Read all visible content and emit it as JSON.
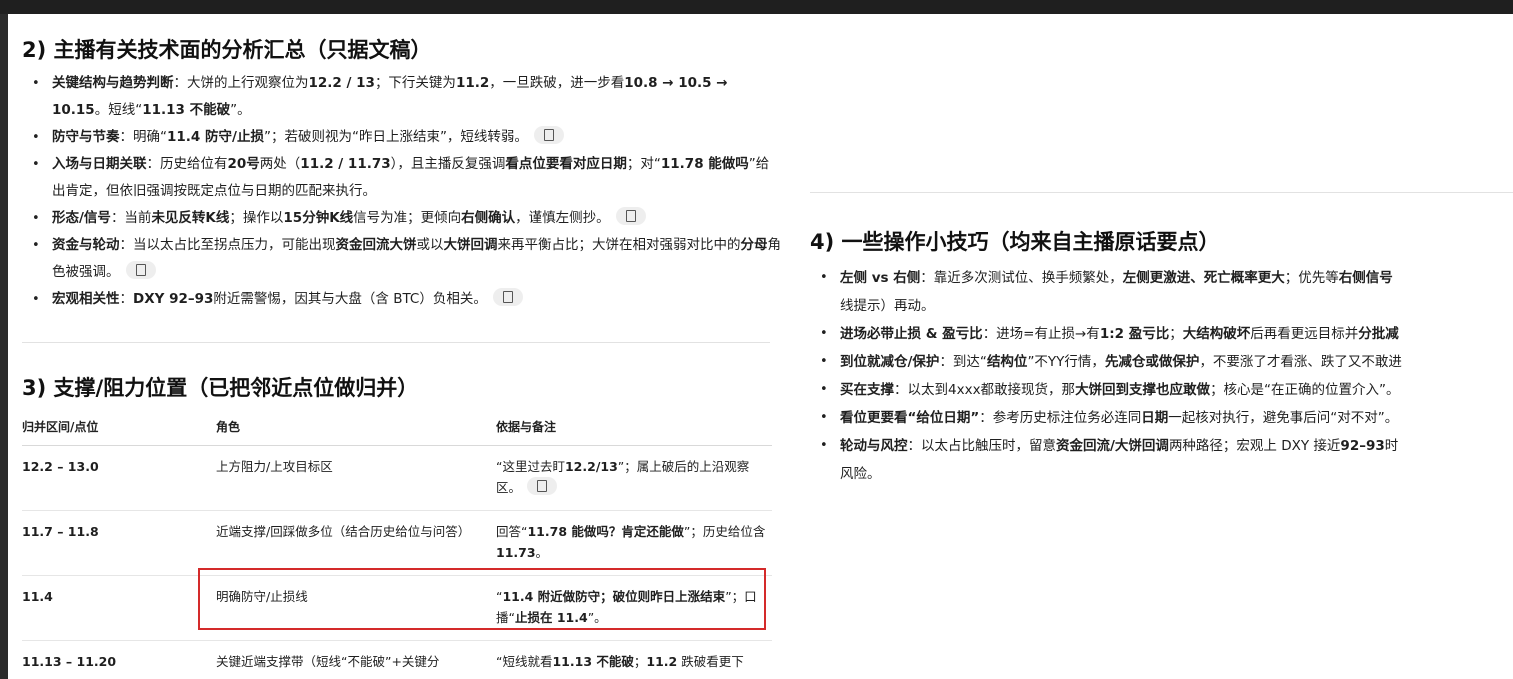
{
  "sec2": {
    "title": "2) 主播有关技术面的分析汇总（只据文稿）",
    "items": [
      {
        "lead": "关键结构与趋势判断",
        "parts": [
          {
            "t": "：大饼的上行观察位为",
            "b": false
          },
          {
            "t": "12.2 / 13",
            "b": true
          },
          {
            "t": "；下行关键为",
            "b": false
          },
          {
            "t": "11.2",
            "b": true
          },
          {
            "t": "，一旦跌破，进一步看",
            "b": false
          },
          {
            "t": "10.8 → 10.5 → 10.15",
            "b": true
          },
          {
            "t": "。短线“",
            "b": false
          },
          {
            "t": "11.13 不能破",
            "b": true
          },
          {
            "t": "”。",
            "b": false
          }
        ],
        "copy": false
      },
      {
        "lead": "防守与节奏",
        "parts": [
          {
            "t": "：明确“",
            "b": false
          },
          {
            "t": "11.4 防守/止损",
            "b": true
          },
          {
            "t": "”；若破则视为“昨日上涨结束”，短线转弱。",
            "b": false
          }
        ],
        "copy": true
      },
      {
        "lead": "入场与日期关联",
        "parts": [
          {
            "t": "：历史给位有",
            "b": false
          },
          {
            "t": "20号",
            "b": true
          },
          {
            "t": "两处（",
            "b": false
          },
          {
            "t": "11.2 / 11.73",
            "b": true
          },
          {
            "t": "），且主播反复强调",
            "b": false
          },
          {
            "t": "看点位要看对应日期",
            "b": true
          },
          {
            "t": "；对“",
            "b": false
          },
          {
            "t": "11.78 能做吗",
            "b": true
          },
          {
            "t": "”给出肯定，但依旧强调按既定点位与日期的匹配来执行。",
            "b": false
          }
        ],
        "copy": false
      },
      {
        "lead": "形态/信号",
        "parts": [
          {
            "t": "：当前",
            "b": false
          },
          {
            "t": "未见反转K线",
            "b": true
          },
          {
            "t": "；操作以",
            "b": false
          },
          {
            "t": "15分钟K线",
            "b": true
          },
          {
            "t": "信号为准；更倾向",
            "b": false
          },
          {
            "t": "右侧确认",
            "b": true
          },
          {
            "t": "，谨慎左侧抄。",
            "b": false
          }
        ],
        "copy": true
      },
      {
        "lead": "资金与轮动",
        "parts": [
          {
            "t": "：当以太占比至拐点压力，可能出现",
            "b": false
          },
          {
            "t": "资金回流大饼",
            "b": true
          },
          {
            "t": "或以",
            "b": false
          },
          {
            "t": "大饼回调",
            "b": true
          },
          {
            "t": "来再平衡占比；大饼在相对强弱对比中的",
            "b": false
          },
          {
            "t": "分母",
            "b": true
          },
          {
            "t": "角色被强调。",
            "b": false
          }
        ],
        "copy": true
      },
      {
        "lead": "宏观相关性",
        "parts": [
          {
            "t": "：",
            "b": false
          },
          {
            "t": "DXY 92–93",
            "b": true
          },
          {
            "t": "附近需警惕，因其与大盘（含 BTC）负相关。",
            "b": false
          }
        ],
        "copy": true
      }
    ]
  },
  "sec3": {
    "title": "3) 支撑/阻力位置（已把邻近点位做归并）",
    "headers": [
      "归并区间/点位",
      "角色",
      "依据与备注"
    ],
    "rows": [
      {
        "range": "12.2 – 13.0",
        "role": "上方阻力/上攻目标区",
        "note": [
          {
            "t": "“这里过去盯",
            "b": false
          },
          {
            "t": "12.2/13",
            "b": true
          },
          {
            "t": "”；属上破后的上沿观察区。",
            "b": false
          }
        ],
        "copy": true
      },
      {
        "range": "11.7 – 11.8",
        "role": "近端支撑/回踩做多位（结合历史给位与问答）",
        "note": [
          {
            "t": "回答“",
            "b": false
          },
          {
            "t": "11.78 能做吗？肯定还能做",
            "b": true
          },
          {
            "t": "”；历史给位含",
            "b": false
          },
          {
            "t": "11.73",
            "b": true
          },
          {
            "t": "。",
            "b": false
          }
        ],
        "copy": false
      },
      {
        "range": "11.4",
        "role": "明确防守/止损线",
        "note": [
          {
            "t": "“",
            "b": false
          },
          {
            "t": "11.4 附近做防守；破位则昨日上涨结束",
            "b": true
          },
          {
            "t": "”；口播“",
            "b": false
          },
          {
            "t": "止损在 11.4",
            "b": true
          },
          {
            "t": "”。",
            "b": false
          }
        ],
        "copy": false
      },
      {
        "range": "11.13 – 11.20",
        "role": "关键近端支撑带（短线“不能破”+关键分",
        "note": [
          {
            "t": "“短线就看",
            "b": false
          },
          {
            "t": "11.13 不能破",
            "b": true
          },
          {
            "t": "；",
            "b": false
          },
          {
            "t": "11.2",
            "b": true
          },
          {
            "t": " 跌破看更下",
            "b": false
          }
        ],
        "copy": false
      }
    ]
  },
  "sec4": {
    "title": "4) 一些操作小技巧（均来自主播原话要点）",
    "items": [
      {
        "lead": "左侧 vs 右侧",
        "parts": [
          {
            "t": "：靠近多次测试位、换手频繁处，",
            "b": false
          },
          {
            "t": "左侧更激进、死亡概率更大",
            "b": true
          },
          {
            "t": "；优先等",
            "b": false
          },
          {
            "t": "右侧信号",
            "b": true
          }
        ],
        "cont": "线提示）再动。"
      },
      {
        "lead": "进场必带止损 & 盈亏比",
        "parts": [
          {
            "t": "：进场=有止损→有",
            "b": false
          },
          {
            "t": "1:2 盈亏比",
            "b": true
          },
          {
            "t": "；",
            "b": false
          },
          {
            "t": "大结构破坏",
            "b": true
          },
          {
            "t": "后再看更远目标并",
            "b": false
          },
          {
            "t": "分批减",
            "b": true
          }
        ]
      },
      {
        "lead": "到位就减仓/保护",
        "parts": [
          {
            "t": "：到达“",
            "b": false
          },
          {
            "t": "结构位",
            "b": true
          },
          {
            "t": "”不YY行情，",
            "b": false
          },
          {
            "t": "先减仓或做保护",
            "b": true
          },
          {
            "t": "，不要涨了才看涨、跌了又不敢进",
            "b": false
          }
        ]
      },
      {
        "lead": "买在支撑",
        "parts": [
          {
            "t": "：以太到4xxx都敢接现货，那",
            "b": false
          },
          {
            "t": "大饼回到支撑也应敢做",
            "b": true
          },
          {
            "t": "；核心是“在正确的位置介入”。",
            "b": false
          }
        ]
      },
      {
        "lead": "看位更要看“给位日期”",
        "parts": [
          {
            "t": "：参考历史标注位务必连同",
            "b": false
          },
          {
            "t": "日期",
            "b": true
          },
          {
            "t": "一起核对执行，避免事后问“对不对”。",
            "b": false
          }
        ]
      },
      {
        "lead": "轮动与风控",
        "parts": [
          {
            "t": "：以太占比触压时，留意",
            "b": false
          },
          {
            "t": "资金回流/大饼回调",
            "b": true
          },
          {
            "t": "两种路径；宏观上 DXY 接近",
            "b": false
          },
          {
            "t": "92–93",
            "b": true
          },
          {
            "t": "时",
            "b": false
          }
        ],
        "cont": "风险。"
      }
    ]
  }
}
